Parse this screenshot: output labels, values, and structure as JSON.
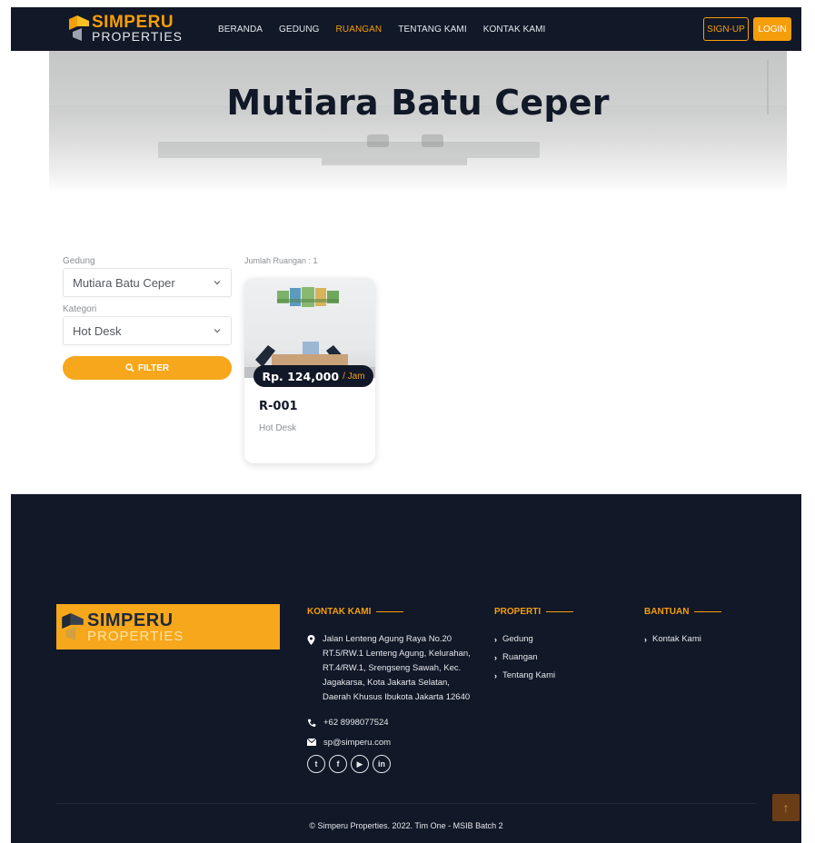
{
  "brand": {
    "name_top": "SIMPERU",
    "name_bottom": "PROPERTIES",
    "accent_color": "#f59e0b",
    "dark_color": "#111827"
  },
  "nav": {
    "items": [
      {
        "label": "BERANDA",
        "active": false
      },
      {
        "label": "GEDUNG",
        "active": false
      },
      {
        "label": "RUANGAN",
        "active": true
      },
      {
        "label": "TENTANG KAMI",
        "active": false
      },
      {
        "label": "KONTAK KAMI",
        "active": false
      }
    ],
    "signup_label": "SIGN-UP",
    "login_label": "LOGIN"
  },
  "hero": {
    "title": "Mutiara Batu Ceper"
  },
  "filter": {
    "gedung_label": "Gedung",
    "gedung_value": "Mutiara Batu Ceper",
    "kategori_label": "Kategori",
    "kategori_value": "Hot Desk",
    "button_label": "FILTER"
  },
  "results": {
    "count_text": "Jumlah Ruangan : 1",
    "rooms": [
      {
        "price": "Rp. 124,000",
        "unit": "/ Jam",
        "code": "R-001",
        "category": "Hot Desk"
      }
    ]
  },
  "footer": {
    "contact_heading": "KONTAK KAMI",
    "address": "Jalan Lenteng Agung Raya No.20 RT.5/RW.1 Lenteng Agung, Kelurahan, RT.4/RW.1, Srengseng Sawah, Kec. Jagakarsa, Kota Jakarta Selatan, Daerah Khusus Ibukota Jakarta 12640",
    "phone": "+62 8998077524",
    "email": "sp@simperu.com",
    "property_heading": "PROPERTI",
    "property_links": [
      "Gedung",
      "Ruangan",
      "Tentang Kami"
    ],
    "help_heading": "BANTUAN",
    "help_links": [
      "Kontak Kami"
    ],
    "social": [
      "twitter",
      "facebook",
      "youtube",
      "linkedin"
    ],
    "copyright": "© Simperu Properties. 2022. Tim One - MSIB Batch 2"
  }
}
